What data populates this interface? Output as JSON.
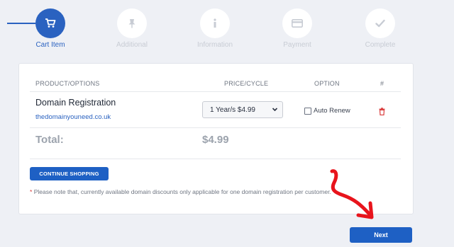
{
  "steps": [
    {
      "label": "Cart Item",
      "icon": "cart-icon",
      "active": true
    },
    {
      "label": "Additional",
      "icon": "pin-icon",
      "active": false
    },
    {
      "label": "Information",
      "icon": "info-icon",
      "active": false
    },
    {
      "label": "Payment",
      "icon": "credit-card-icon",
      "active": false
    },
    {
      "label": "Complete",
      "icon": "check-icon",
      "active": false
    }
  ],
  "table": {
    "headers": {
      "product": "PRODUCT/OPTIONS",
      "price": "PRICE/CYCLE",
      "option": "OPTION",
      "index": "#"
    },
    "row": {
      "product": "Domain Registration",
      "domain": "thedomainyouneed.co.uk",
      "cycle_selected": "1 Year/s $4.99",
      "option_label": "Auto Renew",
      "option_checked": false
    },
    "total_label": "Total:",
    "total_value": "$4.99"
  },
  "buttons": {
    "continue": "CONTINUE SHOPPING",
    "next": "Next"
  },
  "note": {
    "marker": "*",
    "text": "Please note that, currently available domain discounts only applicable for one domain registration per customer."
  },
  "colors": {
    "accent": "#1e60c4",
    "danger": "#d93b3b",
    "annotation_arrow": "#e8141c"
  }
}
